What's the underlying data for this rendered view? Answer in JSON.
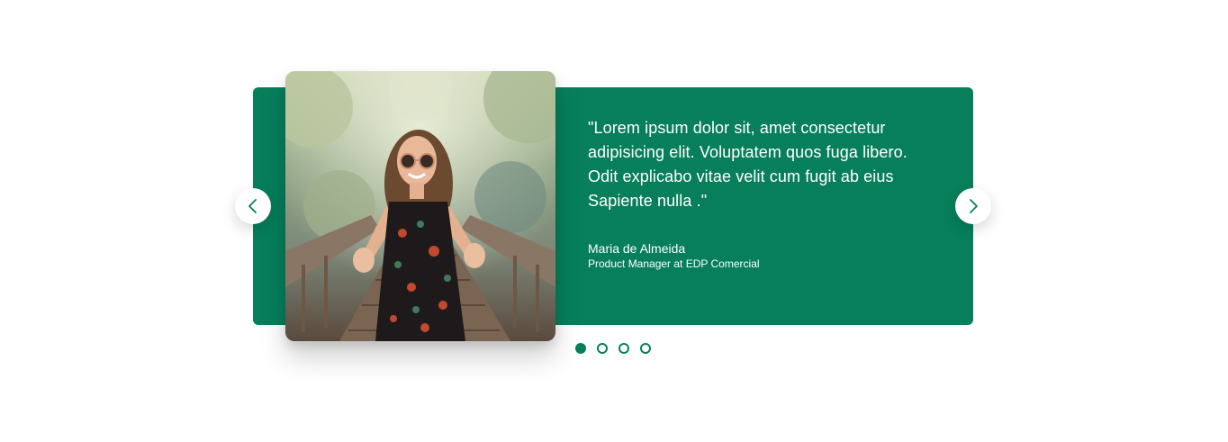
{
  "colors": {
    "brand": "#077f5b",
    "text_on_brand": "#ffffff",
    "background": "#ffffff"
  },
  "testimonial": {
    "quote": "\"Lorem ipsum dolor sit, amet consectetur adipisicing elit. Voluptatem quos fuga libero. Odit explicabo vitae velit cum fugit ab eius Sapiente nulla .\"",
    "author_name": "Maria de Almeida",
    "author_role": "Product Manager at EDP Comercial"
  },
  "navigation": {
    "prev_icon": "chevron-left-icon",
    "next_icon": "chevron-right-icon"
  },
  "pagination": {
    "total": 4,
    "active_index": 0
  }
}
